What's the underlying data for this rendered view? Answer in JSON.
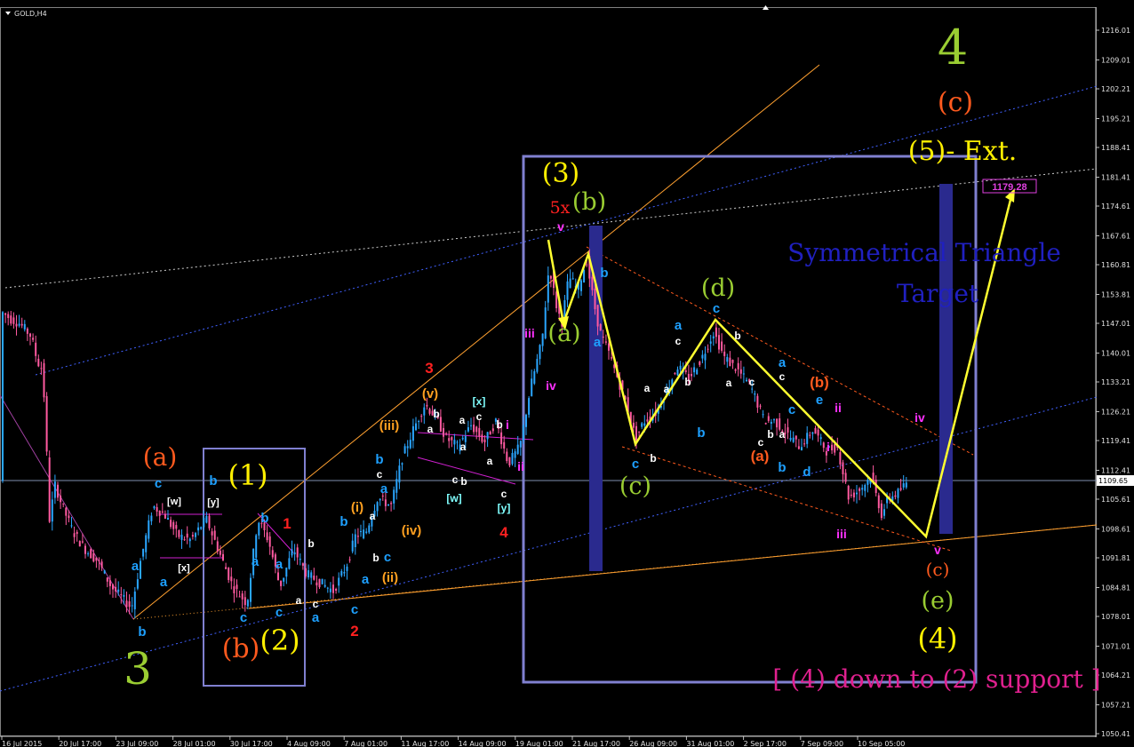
{
  "chart_data": {
    "type": "candlestick",
    "symbol": "GOLD,H4",
    "current_price": "1109.65",
    "target_price": "1179.28",
    "y_ticks": [
      "1216.01",
      "1209.01",
      "1202.21",
      "1195.21",
      "1188.41",
      "1181.41",
      "1174.61",
      "1167.61",
      "1160.81",
      "1153.81",
      "1147.01",
      "1140.01",
      "1133.21",
      "1126.21",
      "1119.41",
      "1112.41",
      "1105.61",
      "1098.61",
      "1091.81",
      "1084.81",
      "1078.01",
      "1071.01",
      "1064.21",
      "1057.21",
      "1050.41"
    ],
    "x_ticks": [
      "16 Jul 2015",
      "20 Jul 17:00",
      "23 Jul 09:00",
      "28 Jul 01:00",
      "30 Jul 17:00",
      "4 Aug 09:00",
      "7 Aug 01:00",
      "11 Aug 17:00",
      "14 Aug 09:00",
      "19 Aug 01:00",
      "21 Aug 17:00",
      "26 Aug 09:00",
      "31 Aug 01:00",
      "2 Sep 17:00",
      "7 Sep 09:00",
      "10 Sep 05:00"
    ],
    "ylim": [
      1049,
      1220
    ],
    "price_path": [
      [
        0,
        1150
      ],
      [
        12,
        1148
      ],
      [
        22,
        1147
      ],
      [
        35,
        1144
      ],
      [
        42,
        1138
      ],
      [
        48,
        1136
      ],
      [
        52,
        1120
      ],
      [
        55,
        1100
      ],
      [
        62,
        1109
      ],
      [
        70,
        1104
      ],
      [
        82,
        1098
      ],
      [
        95,
        1094
      ],
      [
        110,
        1091
      ],
      [
        125,
        1085
      ],
      [
        148,
        1080
      ],
      [
        158,
        1091
      ],
      [
        172,
        1104
      ],
      [
        185,
        1102
      ],
      [
        200,
        1097
      ],
      [
        215,
        1096
      ],
      [
        232,
        1101
      ],
      [
        245,
        1094
      ],
      [
        262,
        1085
      ],
      [
        278,
        1081
      ],
      [
        290,
        1101
      ],
      [
        302,
        1096
      ],
      [
        315,
        1085
      ],
      [
        330,
        1094
      ],
      [
        345,
        1088
      ],
      [
        360,
        1086
      ],
      [
        375,
        1084
      ],
      [
        390,
        1090
      ],
      [
        400,
        1097
      ],
      [
        412,
        1098
      ],
      [
        425,
        1106
      ],
      [
        440,
        1104
      ],
      [
        452,
        1115
      ],
      [
        465,
        1122
      ],
      [
        478,
        1128
      ],
      [
        490,
        1125
      ],
      [
        502,
        1120
      ],
      [
        515,
        1118
      ],
      [
        530,
        1123
      ],
      [
        545,
        1119
      ],
      [
        558,
        1124
      ],
      [
        572,
        1114
      ],
      [
        585,
        1118
      ],
      [
        597,
        1132
      ],
      [
        610,
        1143
      ],
      [
        618,
        1161
      ],
      [
        625,
        1152
      ],
      [
        632,
        1147
      ],
      [
        640,
        1158
      ],
      [
        650,
        1155
      ],
      [
        660,
        1162
      ],
      [
        668,
        1152
      ],
      [
        675,
        1145
      ],
      [
        685,
        1140
      ],
      [
        695,
        1134
      ],
      [
        705,
        1128
      ],
      [
        715,
        1120
      ],
      [
        725,
        1124
      ],
      [
        738,
        1126
      ],
      [
        750,
        1131
      ],
      [
        762,
        1137
      ],
      [
        775,
        1134
      ],
      [
        790,
        1139
      ],
      [
        803,
        1145
      ],
      [
        815,
        1139
      ],
      [
        830,
        1136
      ],
      [
        845,
        1132
      ],
      [
        860,
        1124
      ],
      [
        872,
        1124
      ],
      [
        885,
        1121
      ],
      [
        900,
        1118
      ],
      [
        915,
        1122
      ],
      [
        930,
        1117
      ],
      [
        942,
        1118
      ],
      [
        955,
        1106
      ],
      [
        968,
        1108
      ],
      [
        980,
        1111
      ],
      [
        992,
        1102
      ],
      [
        1000,
        1106
      ],
      [
        1010,
        1107
      ],
      [
        1022,
        1110
      ]
    ],
    "wave_labels": [
      {
        "t": "3",
        "x": 155,
        "y": 770,
        "c": "#9ACD32",
        "s": 50
      },
      {
        "t": "(a)",
        "x": 180,
        "y": 524,
        "c": "#FF5A1E",
        "s": 28
      },
      {
        "t": "c",
        "x": 178,
        "y": 549,
        "c": "#1EA0FF",
        "s": 15
      },
      {
        "t": "a",
        "x": 152,
        "y": 642,
        "c": "#1EA0FF",
        "s": 15
      },
      {
        "t": "a",
        "x": 184,
        "y": 660,
        "c": "#1EA0FF",
        "s": 15
      },
      {
        "t": "b",
        "x": 160,
        "y": 716,
        "c": "#1EA0FF",
        "s": 15
      },
      {
        "t": "[w]",
        "x": 196,
        "y": 568,
        "c": "#ffffff",
        "s": 11
      },
      {
        "t": "[x]",
        "x": 207,
        "y": 643,
        "c": "#ffffff",
        "s": 11
      },
      {
        "t": "[y]",
        "x": 240,
        "y": 569,
        "c": "#ffffff",
        "s": 11
      },
      {
        "t": "b",
        "x": 240,
        "y": 546,
        "c": "#1EA0FF",
        "s": 15
      },
      {
        "t": "(1)",
        "x": 279,
        "y": 546,
        "c": "#FFF000",
        "s": 32
      },
      {
        "t": "(b)",
        "x": 271,
        "y": 740,
        "c": "#FF5A1E",
        "s": 30
      },
      {
        "t": "(2)",
        "x": 315,
        "y": 732,
        "c": "#FFF000",
        "s": 32
      },
      {
        "t": "b",
        "x": 298,
        "y": 588,
        "c": "#1EA0FF",
        "s": 15
      },
      {
        "t": "a",
        "x": 287,
        "y": 637,
        "c": "#1EA0FF",
        "s": 15
      },
      {
        "t": "a",
        "x": 314,
        "y": 640,
        "c": "#1EA0FF",
        "s": 15
      },
      {
        "t": "c",
        "x": 274,
        "y": 700,
        "c": "#1EA0FF",
        "s": 15
      },
      {
        "t": "c",
        "x": 314,
        "y": 694,
        "c": "#1EA0FF",
        "s": 15
      },
      {
        "t": "1",
        "x": 323,
        "y": 595,
        "c": "#FF2020",
        "s": 17
      },
      {
        "t": "b",
        "x": 350,
        "y": 616,
        "c": "#ffffff",
        "s": 12
      },
      {
        "t": "a",
        "x": 336,
        "y": 680,
        "c": "#ffffff",
        "s": 12
      },
      {
        "t": "c",
        "x": 355,
        "y": 684,
        "c": "#ffffff",
        "s": 12
      },
      {
        "t": "a",
        "x": 355,
        "y": 700,
        "c": "#1EA0FF",
        "s": 15
      },
      {
        "t": "b",
        "x": 387,
        "y": 592,
        "c": "#1EA0FF",
        "s": 15
      },
      {
        "t": "c",
        "x": 399,
        "y": 691,
        "c": "#1EA0FF",
        "s": 15
      },
      {
        "t": "2",
        "x": 399,
        "y": 716,
        "c": "#FF2020",
        "s": 17
      },
      {
        "t": "a",
        "x": 411,
        "y": 657,
        "c": "#1EA0FF",
        "s": 15
      },
      {
        "t": "b",
        "x": 423,
        "y": 632,
        "c": "#ffffff",
        "s": 12
      },
      {
        "t": "c",
        "x": 436,
        "y": 632,
        "c": "#1EA0FF",
        "s": 15
      },
      {
        "t": "(i)",
        "x": 402,
        "y": 576,
        "c": "#FFA020",
        "s": 15
      },
      {
        "t": "a",
        "x": 419,
        "y": 585,
        "c": "#ffffff",
        "s": 12
      },
      {
        "t": "(ii)",
        "x": 439,
        "y": 655,
        "c": "#FFA020",
        "s": 15
      },
      {
        "t": "(iii)",
        "x": 438,
        "y": 484,
        "c": "#FFA020",
        "s": 15
      },
      {
        "t": "(iv)",
        "x": 463,
        "y": 602,
        "c": "#FFA020",
        "s": 15
      },
      {
        "t": "b",
        "x": 427,
        "y": 522,
        "c": "#1EA0FF",
        "s": 15
      },
      {
        "t": "c",
        "x": 427,
        "y": 538,
        "c": "#ffffff",
        "s": 12
      },
      {
        "t": "a",
        "x": 432,
        "y": 555,
        "c": "#1EA0FF",
        "s": 15
      },
      {
        "t": "3",
        "x": 483,
        "y": 420,
        "c": "#FF2020",
        "s": 17
      },
      {
        "t": "(v)",
        "x": 484,
        "y": 448,
        "c": "#FFA020",
        "s": 15
      },
      {
        "t": "b",
        "x": 491,
        "y": 470,
        "c": "#ffffff",
        "s": 12
      },
      {
        "t": "a",
        "x": 484,
        "y": 487,
        "c": "#ffffff",
        "s": 12
      },
      {
        "t": "[x]",
        "x": 539,
        "y": 456,
        "c": "#80FFFF",
        "s": 12
      },
      {
        "t": "a",
        "x": 520,
        "y": 477,
        "c": "#ffffff",
        "s": 12
      },
      {
        "t": "c",
        "x": 539,
        "y": 473,
        "c": "#ffffff",
        "s": 12
      },
      {
        "t": "b",
        "x": 562,
        "y": 482,
        "c": "#ffffff",
        "s": 12
      },
      {
        "t": "i",
        "x": 571,
        "y": 483,
        "c": "#FF30FF",
        "s": 14
      },
      {
        "t": "a",
        "x": 521,
        "y": 507,
        "c": "#ffffff",
        "s": 12
      },
      {
        "t": "a",
        "x": 551,
        "y": 523,
        "c": "#ffffff",
        "s": 12
      },
      {
        "t": "c",
        "x": 512,
        "y": 544,
        "c": "#ffffff",
        "s": 12
      },
      {
        "t": "b",
        "x": 522,
        "y": 546,
        "c": "#ffffff",
        "s": 12
      },
      {
        "t": "[w]",
        "x": 511,
        "y": 565,
        "c": "#80FFFF",
        "s": 12
      },
      {
        "t": "c",
        "x": 567,
        "y": 560,
        "c": "#ffffff",
        "s": 12
      },
      {
        "t": "[y]",
        "x": 567,
        "y": 576,
        "c": "#80FFFF",
        "s": 12
      },
      {
        "t": "ii",
        "x": 586,
        "y": 530,
        "c": "#FF30FF",
        "s": 14
      },
      {
        "t": "4",
        "x": 567,
        "y": 605,
        "c": "#FF2020",
        "s": 17
      },
      {
        "t": "iii",
        "x": 596,
        "y": 380,
        "c": "#FF30FF",
        "s": 14
      },
      {
        "t": "iv",
        "x": 620,
        "y": 439,
        "c": "#FF30FF",
        "s": 14
      },
      {
        "t": "(3)",
        "x": 631,
        "y": 205,
        "c": "#FFF000",
        "s": 30
      },
      {
        "t": "5x",
        "x": 630,
        "y": 240,
        "c": "#FF2020",
        "s": 19
      },
      {
        "t": "(b)",
        "x": 663,
        "y": 236,
        "c": "#9ACD32",
        "s": 27
      },
      {
        "t": "v",
        "x": 631,
        "y": 260,
        "c": "#FF30FF",
        "s": 14
      },
      {
        "t": "(a)",
        "x": 635,
        "y": 384,
        "c": "#9ACD32",
        "s": 27
      },
      {
        "t": "b",
        "x": 680,
        "y": 312,
        "c": "#1EA0FF",
        "s": 15
      },
      {
        "t": "a",
        "x": 672,
        "y": 390,
        "c": "#1EA0FF",
        "s": 15
      },
      {
        "t": "a",
        "x": 728,
        "y": 441,
        "c": "#ffffff",
        "s": 12
      },
      {
        "t": "c",
        "x": 715,
        "y": 527,
        "c": "#1EA0FF",
        "s": 15
      },
      {
        "t": "b",
        "x": 735,
        "y": 520,
        "c": "#ffffff",
        "s": 12
      },
      {
        "t": "(c)",
        "x": 715,
        "y": 556,
        "c": "#9ACD32",
        "s": 27
      },
      {
        "t": "a",
        "x": 763,
        "y": 371,
        "c": "#1EA0FF",
        "s": 15
      },
      {
        "t": "c",
        "x": 763,
        "y": 388,
        "c": "#ffffff",
        "s": 12
      },
      {
        "t": "a",
        "x": 750,
        "y": 442,
        "c": "#ffffff",
        "s": 12
      },
      {
        "t": "b",
        "x": 774,
        "y": 434,
        "c": "#ffffff",
        "s": 12
      },
      {
        "t": "b",
        "x": 789,
        "y": 492,
        "c": "#1EA0FF",
        "s": 15
      },
      {
        "t": "(d)",
        "x": 808,
        "y": 333,
        "c": "#9ACD32",
        "s": 27
      },
      {
        "t": "c",
        "x": 806,
        "y": 352,
        "c": "#1EA0FF",
        "s": 15
      },
      {
        "t": "b",
        "x": 830,
        "y": 382,
        "c": "#ffffff",
        "s": 12
      },
      {
        "t": "a",
        "x": 820,
        "y": 435,
        "c": "#ffffff",
        "s": 12
      },
      {
        "t": "c",
        "x": 846,
        "y": 434,
        "c": "#ffffff",
        "s": 12
      },
      {
        "t": "a",
        "x": 880,
        "y": 413,
        "c": "#1EA0FF",
        "s": 15
      },
      {
        "t": "c",
        "x": 880,
        "y": 428,
        "c": "#ffffff",
        "s": 12
      },
      {
        "t": "c",
        "x": 891,
        "y": 466,
        "c": "#1EA0FF",
        "s": 15
      },
      {
        "t": "b",
        "x": 867,
        "y": 493,
        "c": "#ffffff",
        "s": 12
      },
      {
        "t": "a",
        "x": 880,
        "y": 493,
        "c": "#ffffff",
        "s": 12
      },
      {
        "t": "c",
        "x": 856,
        "y": 502,
        "c": "#ffffff",
        "s": 12
      },
      {
        "t": "(a)",
        "x": 855,
        "y": 519,
        "c": "#FF5A1E",
        "s": 17
      },
      {
        "t": "b",
        "x": 880,
        "y": 531,
        "c": "#1EA0FF",
        "s": 15
      },
      {
        "t": "d",
        "x": 908,
        "y": 536,
        "c": "#1EA0FF",
        "s": 15
      },
      {
        "t": "(b)",
        "x": 922,
        "y": 436,
        "c": "#FF5A1E",
        "s": 17
      },
      {
        "t": "e",
        "x": 922,
        "y": 455,
        "c": "#1EA0FF",
        "s": 15
      },
      {
        "t": "ii",
        "x": 943,
        "y": 464,
        "c": "#FF30FF",
        "s": 14
      },
      {
        "t": "i",
        "x": 932,
        "y": 508,
        "c": "#FF30FF",
        "s": 14
      },
      {
        "t": "iii",
        "x": 947,
        "y": 606,
        "c": "#FF30FF",
        "s": 14
      },
      {
        "t": "iv",
        "x": 1035,
        "y": 475,
        "c": "#FF30FF",
        "s": 14
      },
      {
        "t": "v",
        "x": 1055,
        "y": 624,
        "c": "#FF30FF",
        "s": 14
      },
      {
        "t": "(c)",
        "x": 1055,
        "y": 648,
        "c": "#FF5A1E",
        "s": 20
      },
      {
        "t": "(e)",
        "x": 1055,
        "y": 685,
        "c": "#9ACD32",
        "s": 27
      },
      {
        "t": "(4)",
        "x": 1055,
        "y": 730,
        "c": "#FFF000",
        "s": 32
      },
      {
        "t": "4",
        "x": 1072,
        "y": 72,
        "c": "#9ACD32",
        "s": 54
      },
      {
        "t": "(c)",
        "x": 1075,
        "y": 125,
        "c": "#FF5A1E",
        "s": 30
      },
      {
        "t": "(5)- Ext.",
        "x": 1083,
        "y": 180,
        "c": "#FFF000",
        "s": 30
      }
    ]
  },
  "annotations": {
    "target_title": "Symmetrical Triangle",
    "target_sub": "Target",
    "support_note": "[ (4) down to (2) support ]"
  }
}
